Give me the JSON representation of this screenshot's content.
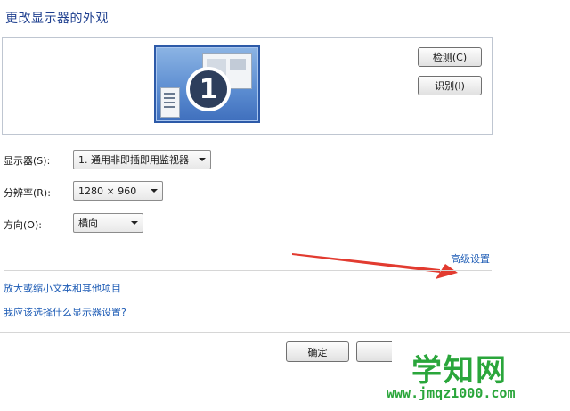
{
  "page_title": "更改显示器的外观",
  "preview": {
    "monitor_number": "1",
    "detect_button": "检测(C)",
    "identify_button": "识别(I)"
  },
  "settings": {
    "display": {
      "label": "显示器(S):",
      "value": "1. 通用非即插即用监视器"
    },
    "resolution": {
      "label": "分辨率(R):",
      "value": "1280 × 960"
    },
    "orientation": {
      "label": "方向(O):",
      "value": "横向"
    }
  },
  "advanced_link": "高级设置",
  "links": {
    "text_size": "放大或缩小文本和其他项目",
    "which_settings": "我应该选择什么显示器设置?"
  },
  "footer": {
    "ok_button": "确定"
  },
  "annotation_arrow": {
    "color": "#e23b30"
  },
  "watermark": {
    "main": "学知网",
    "url": "www.jmqz1000.com"
  }
}
